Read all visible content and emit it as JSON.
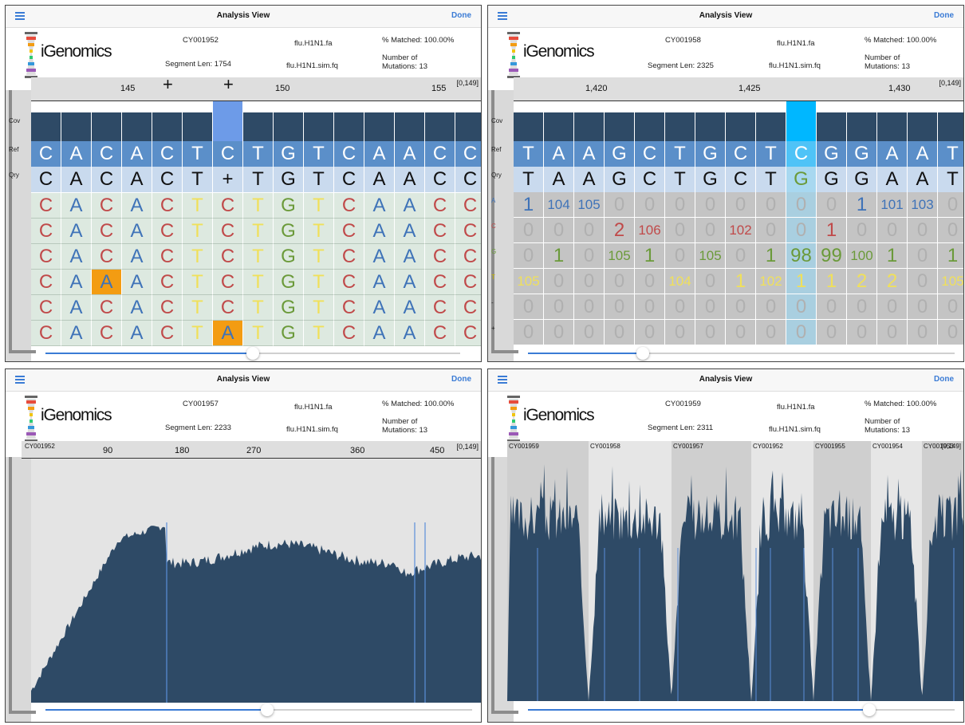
{
  "colors": {
    "accent": "#3a7bd5",
    "cov": "#2e4a66",
    "ref": "#5b8fc9",
    "qry": "#c9daee",
    "read_bg": "#dde9e0",
    "A": "#3f73b8",
    "C": "#c04a4a",
    "G": "#6b9a3a",
    "T": "#f0e05a",
    "highlight": "#f39c12",
    "sel_cov": "#6d9be8",
    "sel_cov2": "#00b7ff"
  },
  "panels": [
    {
      "nav": {
        "title": "Analysis View",
        "done": "Done"
      },
      "logo_text": "iGenomics",
      "info": {
        "segment": "CY001952",
        "seglen": "Segment Len: 1754",
        "ref_file": "flu.H1N1.fa",
        "read_file": "flu.H1N1.sim.fq",
        "matched": "% Matched:  100.00%",
        "mut1": "Number of",
        "mut2": "Mutations: 13"
      },
      "ruler": {
        "ticks": [
          "145",
          "150",
          "155"
        ],
        "range": "[0,149]",
        "plus": [
          "+",
          "+"
        ]
      },
      "row_labels": {
        "cov": "Cov",
        "ref": "Ref",
        "qry": "Qry"
      },
      "coverage_level": 0.72,
      "ref": [
        "C",
        "A",
        "C",
        "A",
        "C",
        "T",
        "C",
        "T",
        "G",
        "T",
        "C",
        "A",
        "A",
        "C",
        "C"
      ],
      "qry": [
        "C",
        "A",
        "C",
        "A",
        "C",
        "T",
        "+",
        "T",
        "G",
        "T",
        "C",
        "A",
        "A",
        "C",
        "C"
      ],
      "reads": [
        [
          "C",
          "A",
          "C",
          "A",
          "C",
          "T",
          "C",
          "T",
          "G",
          "T",
          "C",
          "A",
          "A",
          "C",
          "C"
        ],
        [
          "C",
          "A",
          "C",
          "A",
          "C",
          "T",
          "C",
          "T",
          "G",
          "T",
          "C",
          "A",
          "A",
          "C",
          "C"
        ],
        [
          "C",
          "A",
          "C",
          "A",
          "C",
          "T",
          "C",
          "T",
          "G",
          "T",
          "C",
          "A",
          "A",
          "C",
          "C"
        ],
        [
          "C",
          "A",
          "A",
          "A",
          "C",
          "T",
          "C",
          "T",
          "G",
          "T",
          "C",
          "A",
          "A",
          "C",
          "C"
        ],
        [
          "C",
          "A",
          "C",
          "A",
          "C",
          "T",
          "C",
          "T",
          "G",
          "T",
          "C",
          "A",
          "A",
          "C",
          "C"
        ],
        [
          "C",
          "A",
          "C",
          "A",
          "C",
          "T",
          "A",
          "T",
          "G",
          "T",
          "C",
          "A",
          "A",
          "C",
          "C"
        ]
      ],
      "slider": 0.5
    },
    {
      "nav": {
        "title": "Analysis View",
        "done": "Done"
      },
      "logo_text": "iGenomics",
      "info": {
        "segment": "CY001958",
        "seglen": "Segment Len: 2325",
        "ref_file": "flu.H1N1.fa",
        "read_file": "flu.H1N1.sim.fq",
        "matched": "% Matched:  100.00%",
        "mut1": "Number of",
        "mut2": "Mutations: 13"
      },
      "ruler": {
        "ticks": [
          "1,420",
          "1,425",
          "1,430"
        ],
        "range": "[0,149]"
      },
      "row_labels": {
        "cov": "Cov",
        "ref": "Ref",
        "qry": "Qry",
        "A": "A",
        "C": "C",
        "G": "G",
        "T": "T",
        "del": "-",
        "ins": "+"
      },
      "ref": [
        "T",
        "A",
        "A",
        "G",
        "C",
        "T",
        "G",
        "C",
        "T",
        "C",
        "G",
        "G",
        "A",
        "A",
        "T"
      ],
      "qry": [
        "T",
        "A",
        "A",
        "G",
        "C",
        "T",
        "G",
        "C",
        "T",
        "G",
        "G",
        "G",
        "A",
        "A",
        "T"
      ],
      "counts": {
        "A": [
          "1",
          "104",
          "105",
          "0",
          "0",
          "0",
          "0",
          "0",
          "0",
          "0",
          "0",
          "1",
          "101",
          "103",
          "0"
        ],
        "C": [
          "0",
          "0",
          "0",
          "2",
          "106",
          "0",
          "0",
          "102",
          "0",
          "0",
          "1",
          "0",
          "0",
          "0",
          "0"
        ],
        "G": [
          "0",
          "1",
          "0",
          "105",
          "1",
          "0",
          "105",
          "0",
          "1",
          "98",
          "99",
          "100",
          "1",
          "0",
          "1"
        ],
        "T": [
          "105",
          "0",
          "0",
          "0",
          "0",
          "104",
          "0",
          "1",
          "102",
          "1",
          "1",
          "2",
          "2",
          "0",
          "105"
        ],
        "del": [
          "0",
          "0",
          "0",
          "0",
          "0",
          "0",
          "0",
          "0",
          "0",
          "0",
          "0",
          "0",
          "0",
          "0",
          "0"
        ],
        "ins": [
          "0",
          "0",
          "0",
          "0",
          "0",
          "0",
          "0",
          "0",
          "0",
          "0",
          "0",
          "0",
          "0",
          "0",
          "0"
        ]
      },
      "slider": 0.27
    },
    {
      "nav": {
        "title": "Analysis View",
        "done": "Done"
      },
      "logo_text": "iGenomics",
      "info": {
        "segment": "CY001957",
        "seglen": "Segment Len: 2233",
        "ref_file": "flu.H1N1.fa",
        "read_file": "flu.H1N1.sim.fq",
        "matched": "% Matched:  100.00%",
        "mut1": "Number of",
        "mut2": "Mutations: 13"
      },
      "ruler": {
        "ticks": [
          "90",
          "180",
          "270",
          "360",
          "450"
        ],
        "range": "[0,149]",
        "seg": "CY001952"
      },
      "slider": 0.52
    },
    {
      "nav": {
        "title": "Analysis View",
        "done": "Done"
      },
      "logo_text": "iGenomics",
      "info": {
        "segment": "CY001959",
        "seglen": "Segment Len: 2311",
        "ref_file": "flu.H1N1.fa",
        "read_file": "flu.H1N1.sim.fq",
        "matched": "% Matched:  100.00%",
        "mut1": "Number of",
        "mut2": "Mutations: 13"
      },
      "ruler": {
        "segments": [
          "CY001959",
          "CY001958",
          "CY001957",
          "CY001952",
          "CY001955",
          "CY001954",
          "CY001953"
        ],
        "range": "[0,149]"
      },
      "slider": 0.8
    }
  ]
}
